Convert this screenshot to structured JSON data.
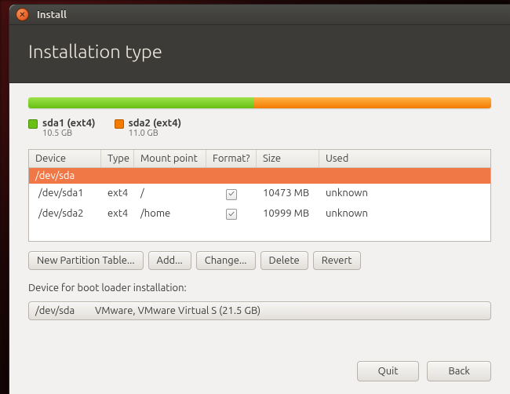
{
  "window": {
    "title": "Install"
  },
  "header": {
    "title": "Installation type"
  },
  "legend": [
    {
      "name": "sda1 (ext4)",
      "size": "10.5 GB",
      "color": "green"
    },
    {
      "name": "sda2 (ext4)",
      "size": "11.0 GB",
      "color": "orange"
    }
  ],
  "bar": {
    "segments": [
      {
        "color": "green",
        "pct": 48.8
      },
      {
        "color": "orange",
        "pct": 51.2
      }
    ]
  },
  "table": {
    "headers": {
      "device": "Device",
      "type": "Type",
      "mount": "Mount point",
      "format": "Format?",
      "size": "Size",
      "used": "Used"
    },
    "disk_label": "/dev/sda",
    "rows": [
      {
        "device": "/dev/sda1",
        "type": "ext4",
        "mount": "/",
        "format": true,
        "size": "10473 MB",
        "used": "unknown"
      },
      {
        "device": "/dev/sda2",
        "type": "ext4",
        "mount": "/home",
        "format": true,
        "size": "10999 MB",
        "used": "unknown"
      }
    ]
  },
  "buttons": {
    "new_table": "New Partition Table...",
    "add": "Add...",
    "change": "Change...",
    "delete": "Delete",
    "revert": "Revert"
  },
  "bootloader": {
    "label": "Device for boot loader installation:",
    "device": "/dev/sda",
    "desc": "VMware, VMware Virtual S (21.5 GB)"
  },
  "footer": {
    "quit": "Quit",
    "back": "Back"
  }
}
